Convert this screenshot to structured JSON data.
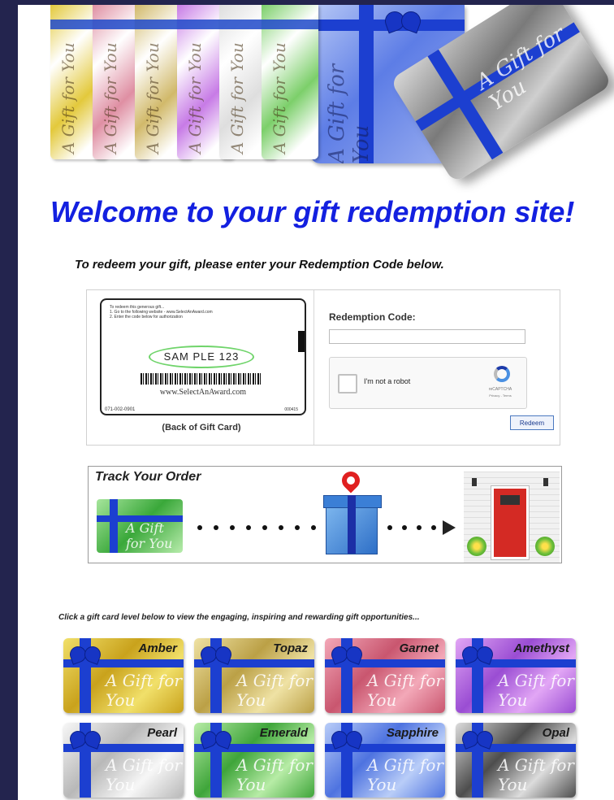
{
  "hero": {
    "card_script": "A Gift for You",
    "fan_colors": [
      "#e3c93c",
      "#df8fa3",
      "#d1b96a",
      "#c77be6",
      "#dedede",
      "#7ccf6a"
    ]
  },
  "heading": "Welcome to your gift redemption site!",
  "instruction": "To redeem your gift, please enter your Redemption Code below.",
  "back_card": {
    "line1": "To redeem this generous gift...",
    "line2": "1. Go to the following website - www.SelectAnAward.com",
    "line3": "2. Enter the code below for authorization",
    "code": "SAM PLE 123",
    "website": "www.SelectAnAward.com",
    "serial": "071-002-0901",
    "serial_right": "000415",
    "caption": "(Back of Gift Card)"
  },
  "redemption": {
    "label": "Redemption Code:",
    "value": "",
    "placeholder": ""
  },
  "captcha": {
    "label": "I'm not a robot",
    "brand": "reCAPTCHA",
    "brand_links": "Privacy - Terms"
  },
  "redeem_button": "Redeem",
  "track": {
    "title": "Track Your Order",
    "card_script": "A Gift for You"
  },
  "levels_prompt": "Click a gift card level below to view the engaging, inspiring and rewarding gift opportunities...",
  "levels": [
    {
      "name": "Amber",
      "color_a": "#f1e06a",
      "color_b": "#c9a21c"
    },
    {
      "name": "Topaz",
      "color_a": "#efe2a4",
      "color_b": "#bba046"
    },
    {
      "name": "Garnet",
      "color_a": "#f3a8b8",
      "color_b": "#c9566f"
    },
    {
      "name": "Amethyst",
      "color_a": "#e2a6f5",
      "color_b": "#9a4dd3"
    },
    {
      "name": "Pearl",
      "color_a": "#f7f7f7",
      "color_b": "#b8b8b8"
    },
    {
      "name": "Emerald",
      "color_a": "#b7eca6",
      "color_b": "#3fa53a"
    },
    {
      "name": "Sapphire",
      "color_a": "#b9cdf8",
      "color_b": "#4e73e0"
    },
    {
      "name": "Opal",
      "color_a": "#dcdcdc",
      "color_b": "#4d4d4d"
    }
  ],
  "level_script": "A Gift for You"
}
